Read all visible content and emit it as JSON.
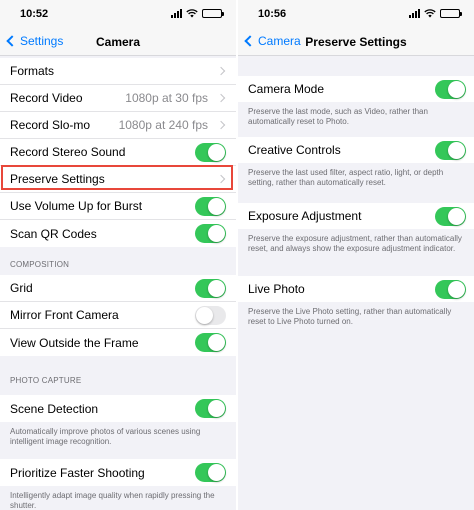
{
  "left": {
    "status_time": "10:52",
    "nav": {
      "back_label": "Settings",
      "title": "Camera"
    },
    "rows_top": [
      {
        "label": "Formats",
        "value": "",
        "control": "chevron"
      },
      {
        "label": "Record Video",
        "value": "1080p at 30 fps",
        "control": "chevron"
      },
      {
        "label": "Record Slo-mo",
        "value": "1080p at 240 fps",
        "control": "chevron"
      },
      {
        "label": "Record Stereo Sound",
        "value": "",
        "control": "toggle-on"
      },
      {
        "label": "Preserve Settings",
        "value": "",
        "control": "chevron"
      },
      {
        "label": "Use Volume Up for Burst",
        "value": "",
        "control": "toggle-on"
      },
      {
        "label": "Scan QR Codes",
        "value": "",
        "control": "toggle-on"
      }
    ],
    "composition_header": "COMPOSITION",
    "composition_rows": [
      {
        "label": "Grid",
        "control": "toggle-on"
      },
      {
        "label": "Mirror Front Camera",
        "control": "toggle-off"
      },
      {
        "label": "View Outside the Frame",
        "control": "toggle-on"
      }
    ],
    "photo_header": "PHOTO CAPTURE",
    "scene_detection": {
      "label": "Scene Detection",
      "footer": "Automatically improve photos of various scenes using intelligent image recognition."
    },
    "faster_shooting": {
      "label": "Prioritize Faster Shooting",
      "footer": "Intelligently adapt image quality when rapidly pressing the shutter."
    }
  },
  "right": {
    "status_time": "10:56",
    "nav": {
      "back_label": "Camera",
      "title": "Preserve Settings"
    },
    "items": [
      {
        "label": "Camera Mode",
        "footer": "Preserve the last mode, such as Video, rather than automatically reset to Photo.",
        "control": "toggle-on"
      },
      {
        "label": "Creative Controls",
        "footer": "Preserve the last used filter, aspect ratio, light, or depth setting, rather than automatically reset.",
        "control": "toggle-on"
      },
      {
        "label": "Exposure Adjustment",
        "footer": "Preserve the exposure adjustment, rather than automatically reset, and always show the exposure adjustment indicator.",
        "control": "toggle-on"
      },
      {
        "label": "Live Photo",
        "footer": "Preserve the Live Photo setting, rather than automatically reset to Live Photo turned on.",
        "control": "toggle-on"
      }
    ]
  },
  "colors": {
    "accent": "#007aff",
    "toggle_on": "#34c759",
    "highlight": "#e8473a"
  },
  "icons": [
    "cellular-signal-icon",
    "wifi-icon",
    "battery-icon",
    "chevron-left-icon",
    "chevron-right-icon"
  ]
}
